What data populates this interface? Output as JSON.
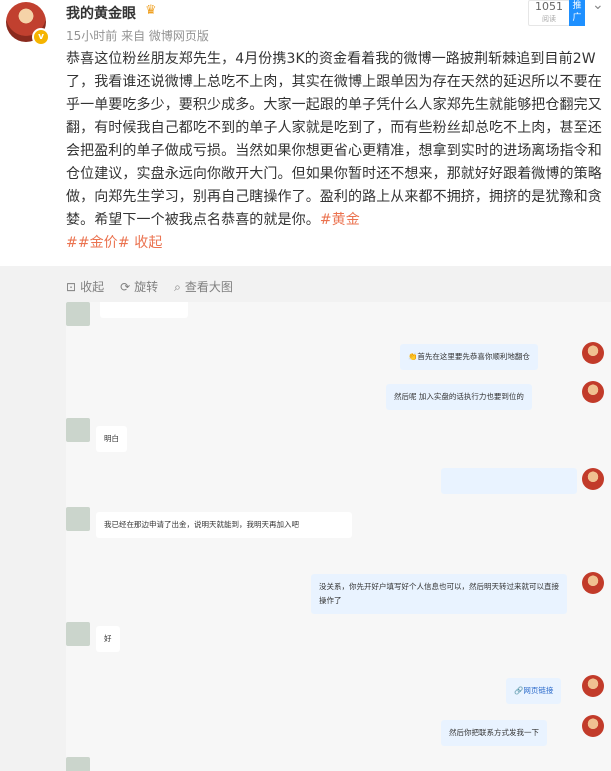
{
  "header": {
    "username": "我的黄金眼",
    "meta": "15小时前 来自 微博网页版",
    "read_count": "1051",
    "read_label": "阅读",
    "promote_label": "推广"
  },
  "post": {
    "text": "恭喜这位粉丝朋友郑先生，4月份携3K的资金看着我的微博一路披荆斩棘追到目前2W了，我看谁还说微博上总吃不上肉，其实在微博上跟单因为存在天然的延迟所以不要在乎一单要吃多少，要积少成多。大家一起跟的单子凭什么人家郑先生就能够把仓翻完又翻，有时候我自己都吃不到的单子人家就是吃到了，而有些粉丝却总吃不上肉，甚至还会把盈利的单子做成亏损。当然如果你想更省心更精准，想拿到实时的进场离场指令和仓位建议，实盘永远向你敞开大门。但如果你暂时还不想来，那就好好跟着微博的策略做，向郑先生学习，别再自己瞎操作了。盈利的路上从来都不拥挤，拥挤的是犹豫和贪婪。希望下一个被我点名恭喜的就是你。",
    "hashtag1": "#黄金",
    "hashtag2": "##金价#",
    "fav": " 收起"
  },
  "toolbar": {
    "collapse": "收起",
    "rotate": "旋转",
    "view_large": "查看大图"
  },
  "chat": {
    "m0": "",
    "m1": "首先在这里要先恭喜你顺利地翻仓",
    "m2": "然后呢 加入实盘的话执行力也要到位的",
    "m3": "明白",
    "m4": "",
    "m5": "我已经在那边申请了出金，说明天就能到，我明天再加入吧",
    "m6": "没关系，你先开好户填写好个人信息也可以，然后明天转过来就可以直接操作了",
    "m7": "好",
    "m8": "网页链接",
    "m9": "然后你把联系方式发我一下"
  }
}
